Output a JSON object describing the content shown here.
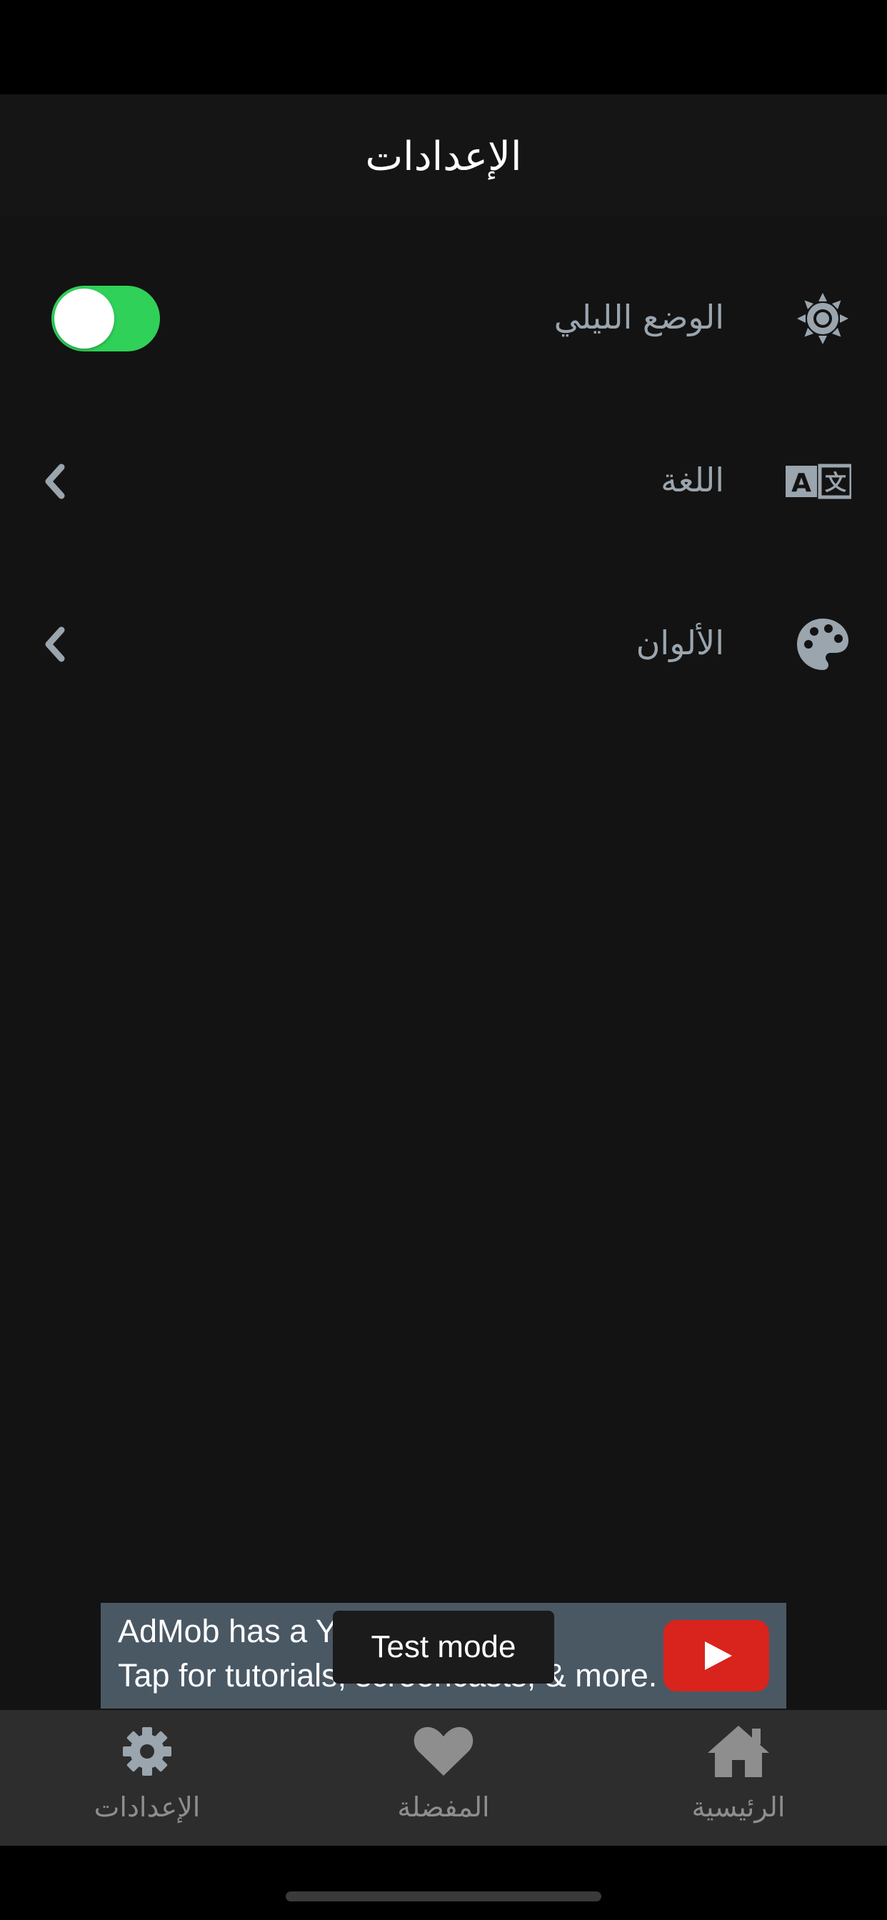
{
  "header": {
    "title": "الإعدادات"
  },
  "settings": {
    "night_mode": {
      "label": "الوضع الليلي",
      "icon": "sun-icon",
      "enabled": true
    },
    "language": {
      "label": "اللغة",
      "icon": "translate-icon"
    },
    "colors": {
      "label": "الألوان",
      "icon": "palette-icon"
    }
  },
  "ad": {
    "line1": "AdMob has a Yo",
    "line2": "Tap for tutorials, screencasts, & more.",
    "badge": "Test mode",
    "icon": "youtube-play-icon"
  },
  "nav": {
    "settings": {
      "label": "الإعدادات",
      "icon": "gear-icon"
    },
    "favorites": {
      "label": "المفضلة",
      "icon": "heart-icon"
    },
    "home": {
      "label": "الرئيسية",
      "icon": "home-icon"
    }
  },
  "colors": {
    "background": "#131313",
    "toggle_on": "#30d158",
    "icon": "#9aa5ae",
    "nav_background": "#2d2d2d",
    "ad_background": "#4a5864",
    "youtube_red": "#d9231d"
  }
}
